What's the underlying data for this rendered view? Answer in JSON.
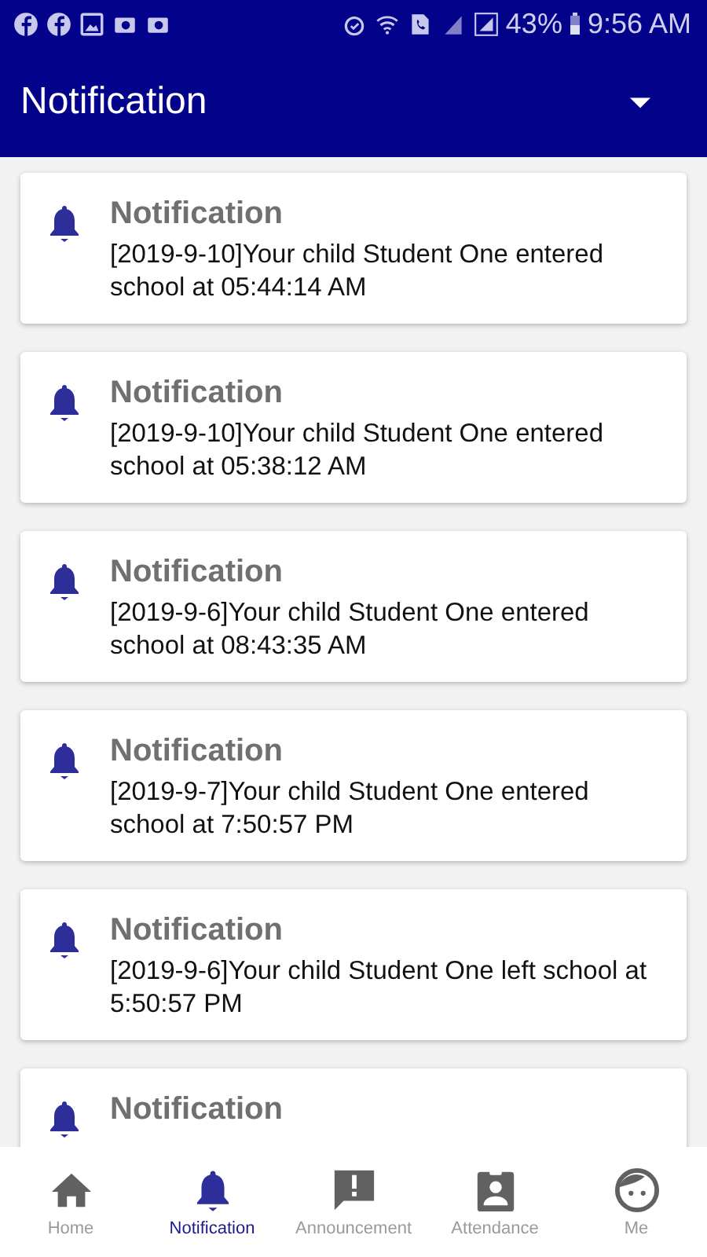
{
  "status_bar": {
    "battery": "43%",
    "time": "9:56 AM"
  },
  "header": {
    "title": "Notification"
  },
  "notifications": [
    {
      "title": "Notification",
      "message": "[2019-9-10]Your child Student One entered school at 05:44:14 AM"
    },
    {
      "title": "Notification",
      "message": "[2019-9-10]Your child Student One entered school at 05:38:12 AM"
    },
    {
      "title": "Notification",
      "message": "[2019-9-6]Your child Student One entered school at 08:43:35 AM"
    },
    {
      "title": "Notification",
      "message": "[2019-9-7]Your child Student One entered school at 7:50:57 PM"
    },
    {
      "title": "Notification",
      "message": "[2019-9-6]Your child Student One left school at 5:50:57 PM"
    },
    {
      "title": "Notification"
    }
  ],
  "bottom_nav": [
    {
      "label": "Home",
      "kind": "home",
      "selected": false
    },
    {
      "label": "Notification",
      "kind": "bell",
      "selected": true
    },
    {
      "label": "Announcement",
      "kind": "announce",
      "selected": false
    },
    {
      "label": "Attendance",
      "kind": "badge",
      "selected": false
    },
    {
      "label": "Me",
      "kind": "face",
      "selected": false
    }
  ]
}
